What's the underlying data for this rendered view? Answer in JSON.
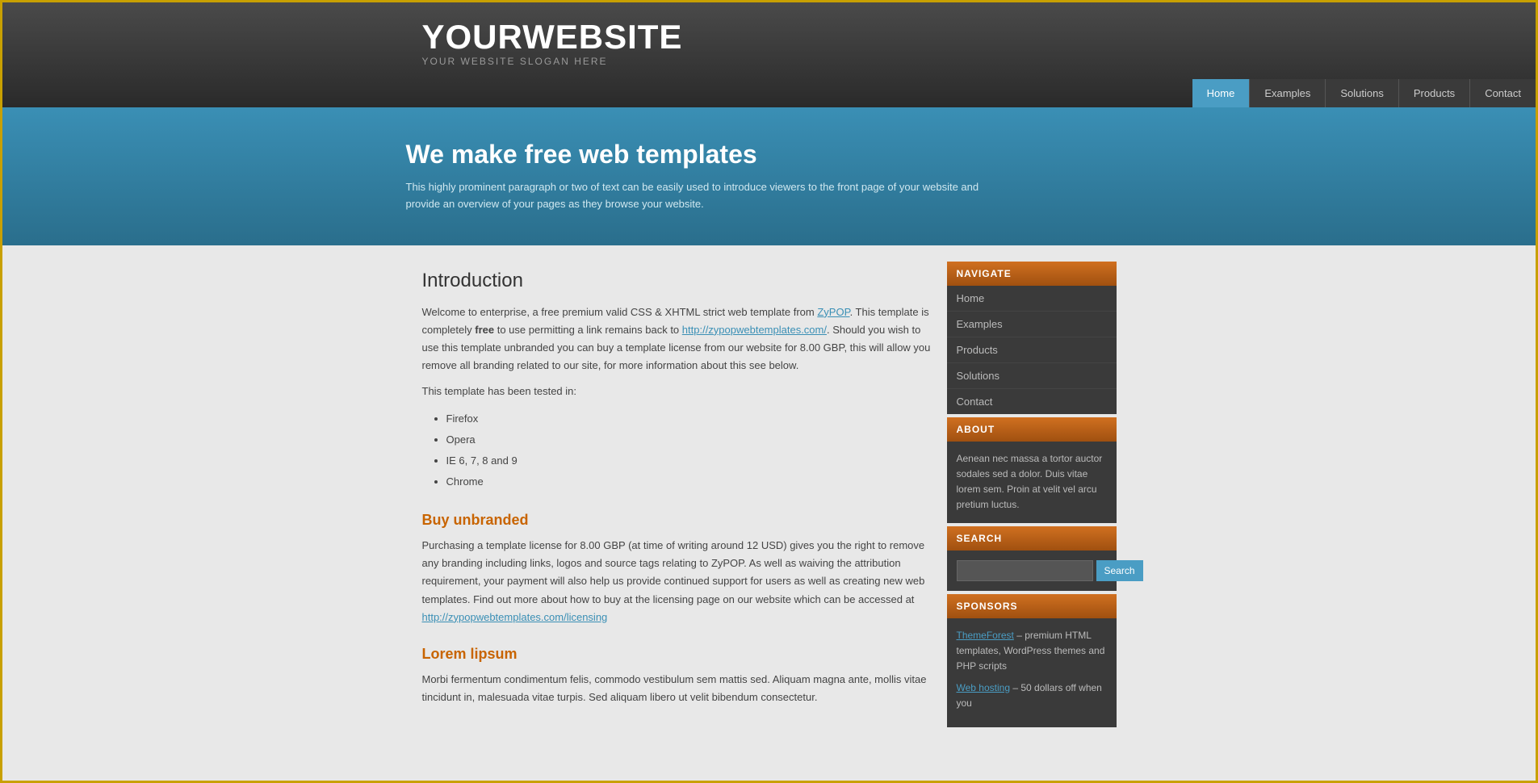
{
  "header": {
    "site_title": "YOURWEBSITE",
    "site_slogan": "YOUR WEBSITE SLOGAN HERE"
  },
  "nav": {
    "items": [
      {
        "label": "Home",
        "active": true
      },
      {
        "label": "Examples",
        "active": false
      },
      {
        "label": "Solutions",
        "active": false
      },
      {
        "label": "Products",
        "active": false
      },
      {
        "label": "Contact",
        "active": false
      }
    ]
  },
  "hero": {
    "heading": "We make free web templates",
    "description": "This highly prominent paragraph or two of text can be easily used to introduce viewers to the front page of your website and provide an overview of your pages as they browse your website."
  },
  "content": {
    "intro_heading": "Introduction",
    "intro_p1_pre": "Welcome to enterprise, a free premium valid CSS & XHTML strict web template from ",
    "intro_p1_link_text": "ZyPOP",
    "intro_p1_link_url": "#",
    "intro_p1_mid": ". This template is completely ",
    "intro_p1_bold": "free",
    "intro_p1_mid2": " to use permitting a link remains back to ",
    "intro_p1_link2_text": "http://zypopwebtemplates.com/",
    "intro_p1_link2_url": "#",
    "intro_p1_end": ". Should you wish to use this template unbranded you can buy a template license from our website for 8.00 GBP, this will allow you remove all branding related to our site, for more information about this see below.",
    "tested_heading": "This template has been tested in:",
    "tested_items": [
      "Firefox",
      "Opera",
      "IE 6, 7, 8 and 9",
      "Chrome"
    ],
    "buy_heading": "Buy unbranded",
    "buy_p": "Purchasing a template license for 8.00 GBP (at time of writing around 12 USD) gives you the right to remove any branding including links, logos and source tags relating to ZyPOP. As well as waiving the attribution requirement, your payment will also help us provide continued support for users as well as creating new web templates. Find out more about how to buy at the licensing page on our website which can be accessed at ",
    "buy_link_text": "http://zypopwebtemplates.com/licensing",
    "buy_link_url": "#",
    "lorem_heading": "Lorem lipsum",
    "lorem_p": "Morbi fermentum condimentum felis, commodo vestibulum sem mattis sed. Aliquam magna ante, mollis vitae tincidunt in, malesuada vitae turpis. Sed aliquam libero ut velit bibendum consectetur."
  },
  "sidebar": {
    "navigate_label": "NAVIGATE",
    "nav_items": [
      "Home",
      "Examples",
      "Products",
      "Solutions",
      "Contact"
    ],
    "about_label": "ABOUT",
    "about_text": "Aenean nec massa a tortor auctor sodales sed a dolor. Duis vitae lorem sem. Proin at velit vel arcu pretium luctus.",
    "search_label": "SEARCH",
    "search_placeholder": "",
    "search_button": "Search",
    "sponsors_label": "SPONSORS",
    "sponsor1_link": "ThemeForest",
    "sponsor1_text": " – premium HTML templates, WordPress themes and PHP scripts",
    "sponsor2_link": "Web hosting",
    "sponsor2_text": " – 50 dollars off when you"
  }
}
